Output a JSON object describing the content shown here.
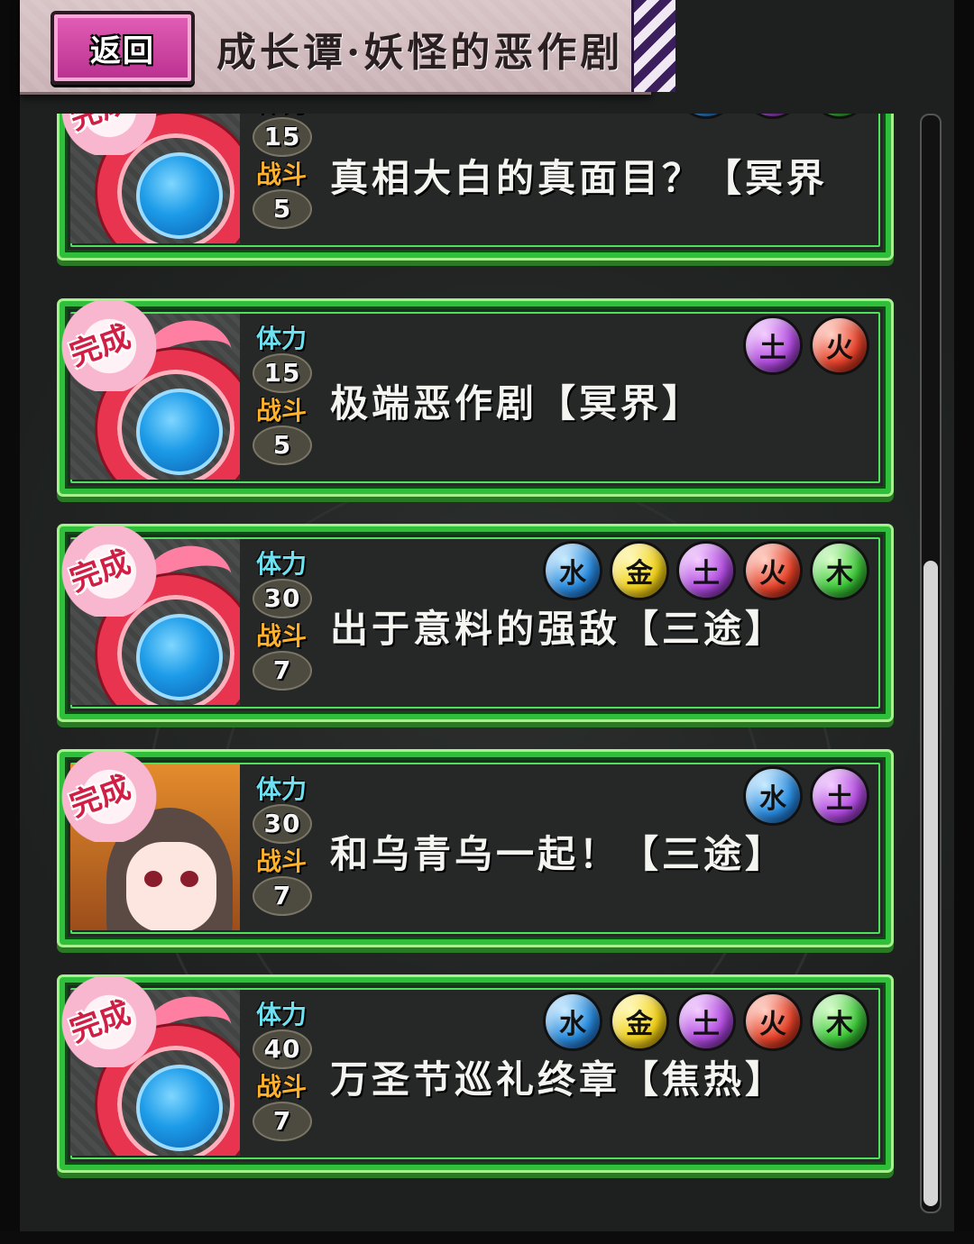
{
  "header": {
    "back_label": "返回",
    "title": "成长谭·妖怪的恶作剧"
  },
  "labels": {
    "stamina": "体力",
    "battle": "战斗",
    "completed": "完成"
  },
  "quests": [
    {
      "name": "真相大白的真面目？【冥界",
      "stamina": "15",
      "battle": "5",
      "orbs": [
        "water-orb-icon",
        "earth-orb-icon",
        "wood-orb-icon"
      ]
    },
    {
      "name": "极端恶作剧【冥界】",
      "stamina": "15",
      "battle": "5",
      "orbs": [
        "earth-orb-icon",
        "fire-orb-icon"
      ]
    },
    {
      "name": "出于意料的强敌【三途】",
      "stamina": "30",
      "battle": "7",
      "orbs": [
        "water-orb-icon",
        "metal-orb-icon",
        "earth-orb-icon",
        "fire-orb-icon",
        "wood-orb-icon"
      ]
    },
    {
      "name": "和乌青乌一起！【三途】",
      "stamina": "30",
      "battle": "7",
      "orbs": [
        "water-orb-icon",
        "earth-orb-icon"
      ]
    },
    {
      "name": "万圣节巡礼终章【焦热】",
      "stamina": "40",
      "battle": "7",
      "orbs": [
        "water-orb-icon",
        "metal-orb-icon",
        "earth-orb-icon",
        "fire-orb-icon",
        "wood-orb-icon"
      ]
    }
  ],
  "colors": {
    "card_border": "#2fbf3a",
    "back_button": "#d343a6",
    "stamina_label": "#6fe0f0",
    "battle_label": "#ffb12a"
  }
}
